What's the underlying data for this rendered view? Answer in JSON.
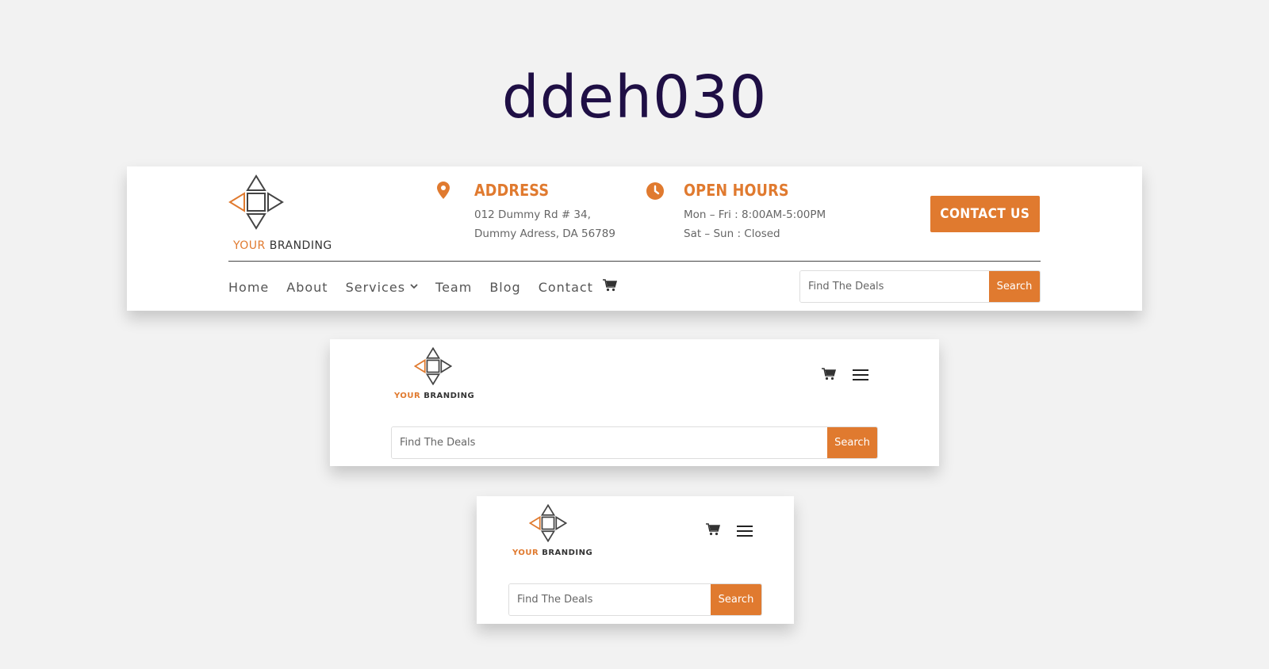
{
  "title": "ddeh030",
  "colors": {
    "accent": "#e07a2f",
    "title": "#1f0f45",
    "background": "#f2f2f2"
  },
  "brand": {
    "accent_word": "YOUR",
    "word": "BRANDING"
  },
  "desktop": {
    "address": {
      "icon": "map-pin-icon",
      "title": "ADDRESS",
      "line1": "012 Dummy Rd # 34,",
      "line2": "Dummy Adress, DA 56789"
    },
    "hours": {
      "icon": "clock-icon",
      "title": "OPEN HOURS",
      "line1": "Mon – Fri : 8:00AM-5:00PM",
      "line2": "Sat – Sun : Closed"
    },
    "contact_label": "CONTACT US",
    "nav": [
      "Home",
      "About",
      "Services",
      "Team",
      "Blog",
      "Contact"
    ],
    "search": {
      "placeholder": "Find The Deals",
      "button": "Search"
    }
  },
  "tablet": {
    "search": {
      "placeholder": "Find The Deals",
      "button": "Search"
    }
  },
  "mobile": {
    "search": {
      "placeholder": "Find The Deals",
      "button": "Search"
    }
  }
}
